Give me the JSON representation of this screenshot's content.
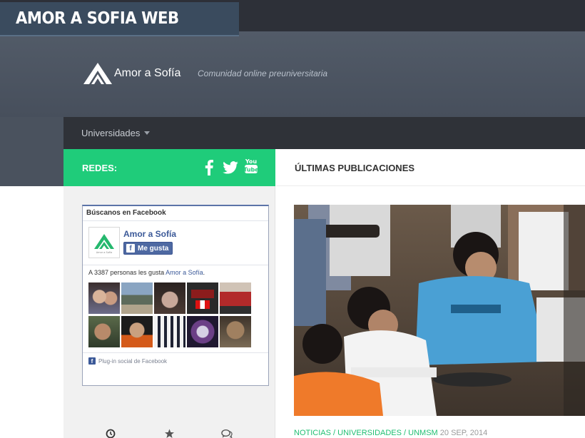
{
  "overlay": {
    "title": "AMOR A SOFIA WEB"
  },
  "brand": {
    "name": "Amor a Sofía",
    "tagline": "Comunidad online preuniversitaria"
  },
  "nav": {
    "items": [
      {
        "label": "Universidades",
        "has_dropdown": true
      }
    ]
  },
  "redes": {
    "label": "REDES:",
    "icons": [
      "facebook-icon",
      "twitter-icon",
      "youtube-icon"
    ]
  },
  "latest": {
    "title": "ÚLTIMAS PUBLICACIONES"
  },
  "facebook_box": {
    "title": "Búscanos en Facebook",
    "page_name": "Amor a Sofía",
    "thumb_text": "Amor a Sofía",
    "like_label": "Me gusta",
    "fans_prefix": "A 3387 personas les gusta",
    "fans_link": "Amor a Sofía",
    "fans_suffix": ".",
    "plugin_label": "Plug-in social de Facebook"
  },
  "sidebar_tabs": [
    "clock-icon",
    "star-icon",
    "comments-icon"
  ],
  "post": {
    "categories": [
      "NOTICIAS",
      "UNIVERSIDADES",
      "UNMSM"
    ],
    "separator": " / ",
    "date": "20 SEP, 2014"
  },
  "colors": {
    "accent_green": "#1fcc7a",
    "header_bg": "#4c5462",
    "nav_bg": "#2f3238",
    "facebook_blue": "#3b5998"
  }
}
